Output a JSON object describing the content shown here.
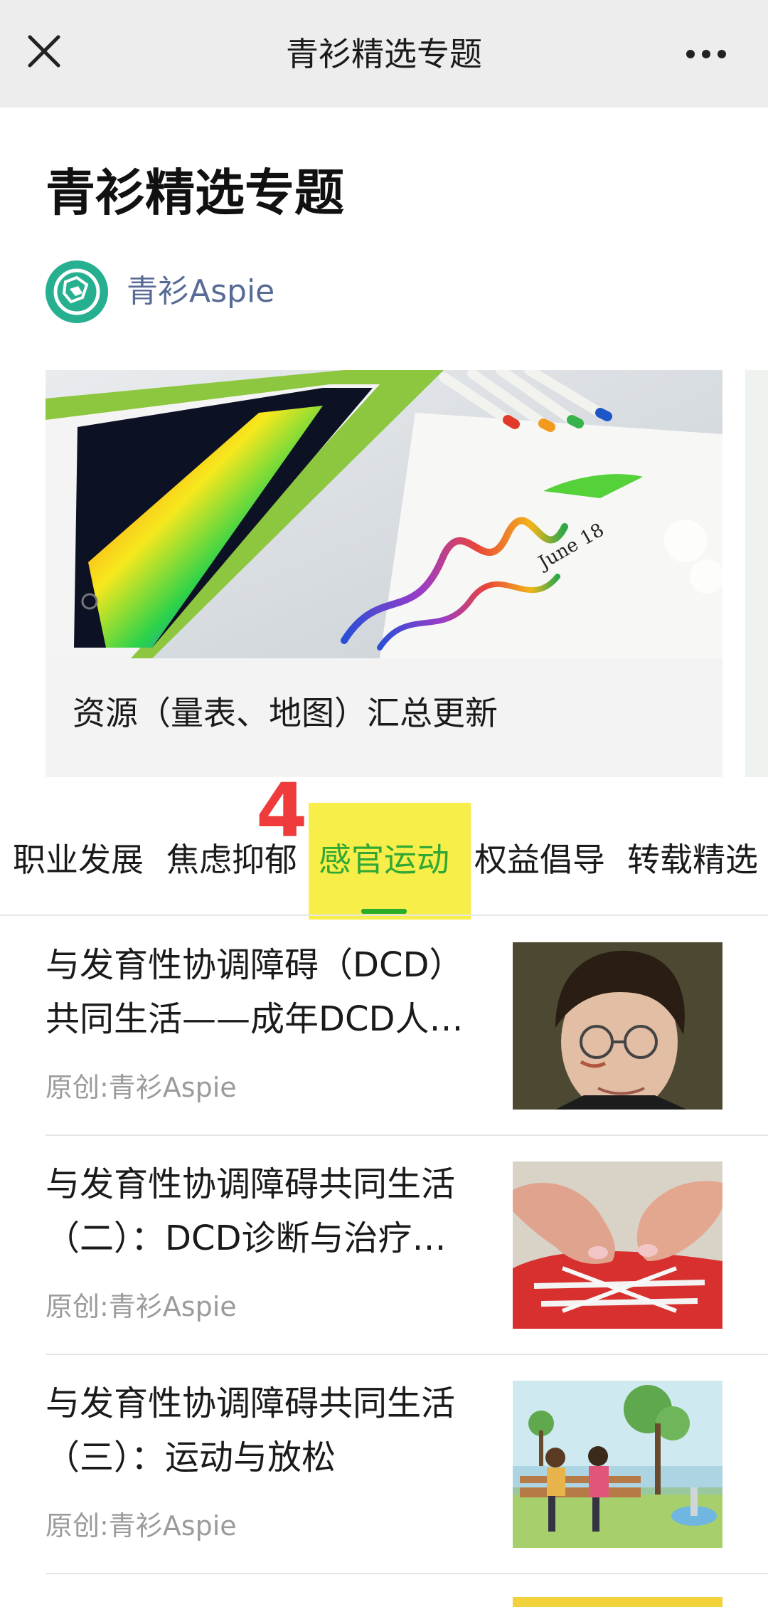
{
  "topbar": {
    "title": "青衫精选专题",
    "close_icon": "close-icon",
    "more_icon": "more-icon"
  },
  "header": {
    "title": "青衫精选专题",
    "account_name": "青衫Aspie"
  },
  "banner": {
    "caption": "资源（量表、地图）汇总更新"
  },
  "annotation": {
    "number": "4"
  },
  "tabs": [
    {
      "label": "职业发展",
      "active": false
    },
    {
      "label": "焦虑抑郁",
      "active": false
    },
    {
      "label": "感官运动",
      "active": true
    },
    {
      "label": "权益倡导",
      "active": false
    },
    {
      "label": "转载精选",
      "active": false
    }
  ],
  "articles": [
    {
      "title_line1": "与发育性协调障碍（DCD）",
      "title_line2": "共同生活——成年DCD人…",
      "source": "原创:青衫Aspie"
    },
    {
      "title_line1": "与发育性协调障碍共同生活",
      "title_line2": "（二）：DCD诊断与治疗…",
      "source": "原创:青衫Aspie"
    },
    {
      "title_line1": "与发育性协调障碍共同生活",
      "title_line2": "（三）：运动与放松",
      "source": "原创:青衫Aspie"
    }
  ],
  "colors": {
    "active_tab": "#32a834",
    "account_link": "#576b95",
    "annotation_red": "#ef3b3b",
    "highlight_yellow": "#f7ee4a"
  }
}
